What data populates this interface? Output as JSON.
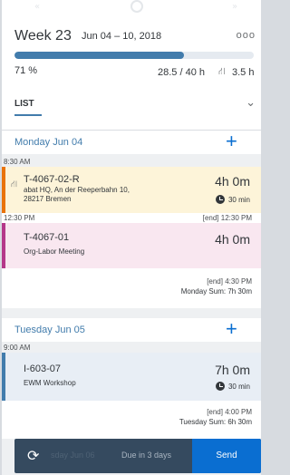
{
  "header": {
    "week_title": "Week 23",
    "date_range": "Jun 04 – 10, 2018",
    "more_icon": "ooo",
    "progress_fraction": 0.71,
    "percent_label": "71 %",
    "hours_label": "28.5 / 40 h",
    "travel_icon": "travel-icon",
    "travel_label": "3.5 h",
    "tab_label": "LIST"
  },
  "days": [
    {
      "label": "Monday Jun 04",
      "add_symbol": "+",
      "sum": "Monday Sum: 7h 30m",
      "entries": [
        {
          "start": "8:30 AM",
          "code": "T-4067-02-R",
          "line1": "abat HQ, An der Reeperbahn 10,",
          "line2": "28217 Bremen",
          "duration": "4h 0m",
          "break": "30 min",
          "end": "[end] 12:30 PM"
        },
        {
          "start": "12:30 PM",
          "code": "T-4067-01",
          "line1": "Org-Labor Meeting",
          "duration": "4h 0m",
          "end": "[end] 4:30 PM"
        }
      ]
    },
    {
      "label": "Tuesday Jun 05",
      "add_symbol": "+",
      "sum": "Tuesday Sum: 6h 30m",
      "entries": [
        {
          "start": "9:00 AM",
          "code": "I-603-07",
          "line1": "EWM Workshop",
          "duration": "7h 0m",
          "break": "30 min",
          "end": "[end] 4:00 PM"
        }
      ]
    }
  ],
  "footer": {
    "ghost_text": "sday Jun 06",
    "due_label": "Due in 3 days",
    "send_label": "Send"
  }
}
